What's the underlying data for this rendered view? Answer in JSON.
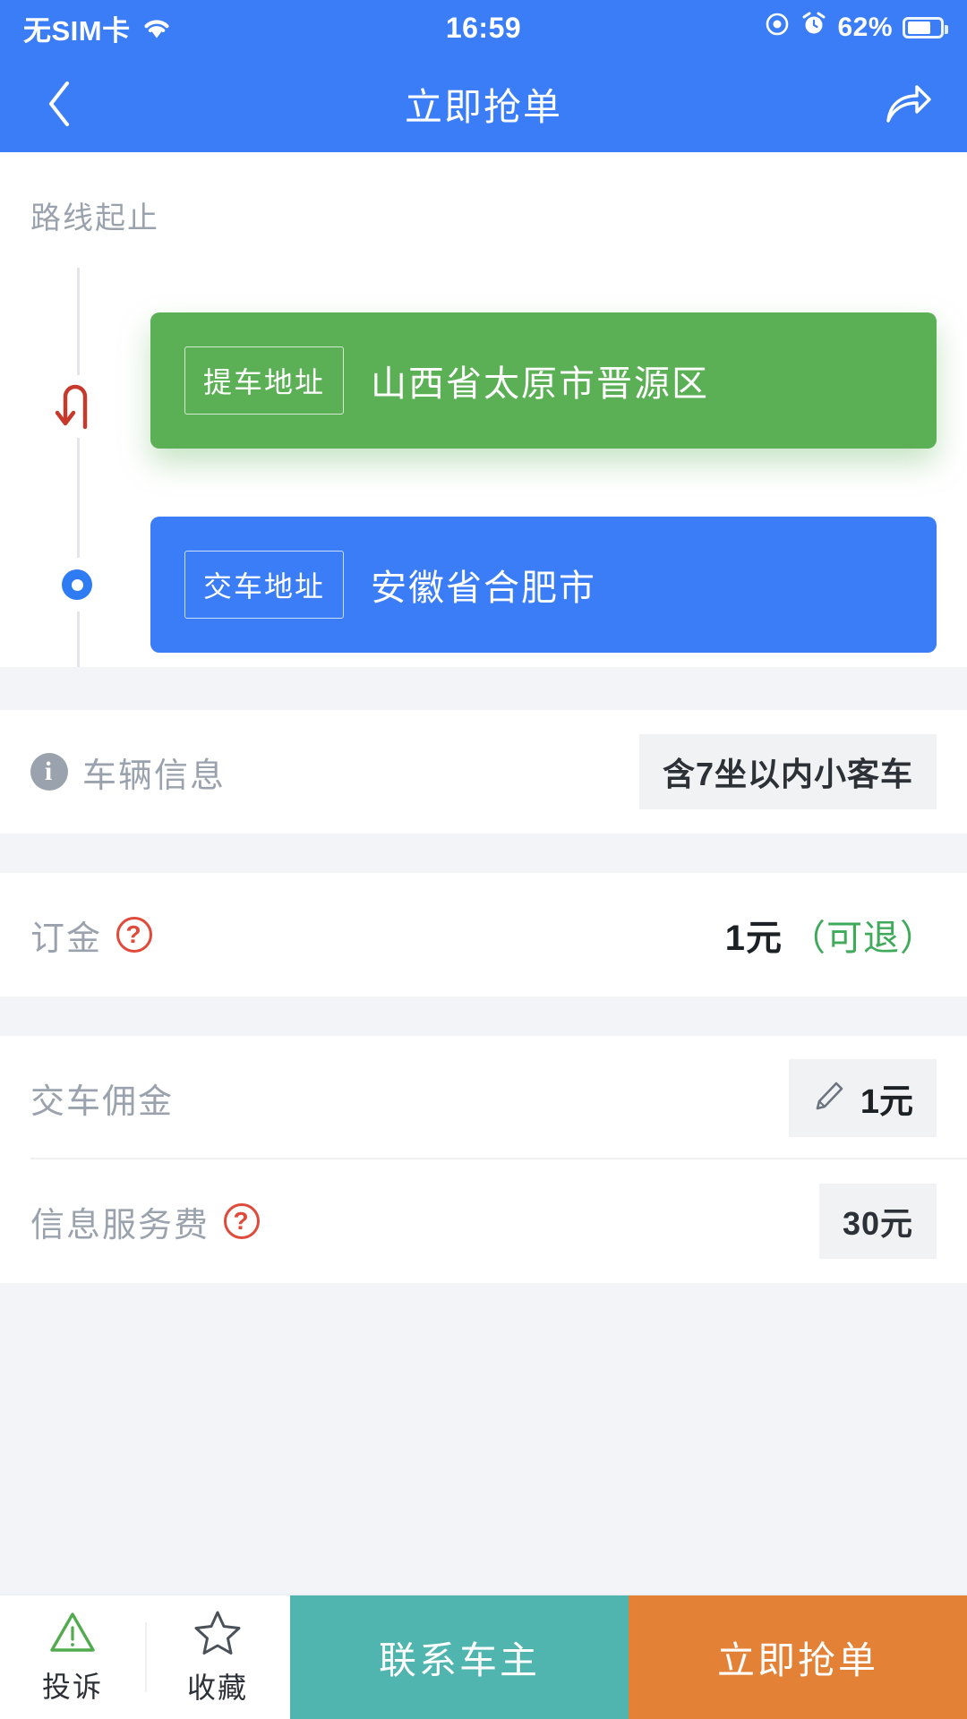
{
  "status_bar": {
    "carrier": "无SIM卡",
    "wifi_icon": "wifi-icon",
    "time": "16:59",
    "screen_record_icon": "screen-record-icon",
    "alarm_icon": "alarm-clock-icon",
    "battery_percent": "62%",
    "battery_icon": "battery-icon"
  },
  "nav": {
    "back_icon": "chevron-left-icon",
    "title": "立即抢单",
    "share_icon": "share-arrow-icon"
  },
  "route": {
    "section_title": "路线起止",
    "pickup": {
      "marker_icon": "u-turn-arrow-icon",
      "badge": "提车地址",
      "address": "山西省太原市晋源区"
    },
    "dropoff": {
      "marker_icon": "location-dot-icon",
      "badge": "交车地址",
      "address": "安徽省合肥市"
    }
  },
  "details": [
    {
      "name": "vehicle-info",
      "icon": "info-circle-icon",
      "label": "车辆信息",
      "value": "含7坐以内小客车"
    },
    {
      "name": "deposit",
      "icon": "question-mark-icon",
      "label": "订金",
      "value": "1元",
      "note": "（可退）"
    },
    {
      "name": "delivery-commission",
      "icon": "pencil-edit-icon",
      "label": "交车佣金",
      "value": "1元"
    },
    {
      "name": "info-service-fee",
      "icon": "question-mark-icon",
      "label": "信息服务费",
      "value": "30元"
    }
  ],
  "bottom_bar": {
    "complaint": {
      "icon": "warning-triangle-icon",
      "label": "投诉"
    },
    "favorite": {
      "icon": "star-outline-icon",
      "label": "收藏"
    },
    "contact_owner": "联系车主",
    "grab_order": "立即抢单"
  },
  "colors": {
    "brand_blue": "#3B7DF7",
    "pickup_green": "#5BAF55",
    "teal": "#4FB5AE",
    "orange": "#E38136",
    "refund_green": "#3FAA5A",
    "alert_red": "#E04A3A"
  }
}
